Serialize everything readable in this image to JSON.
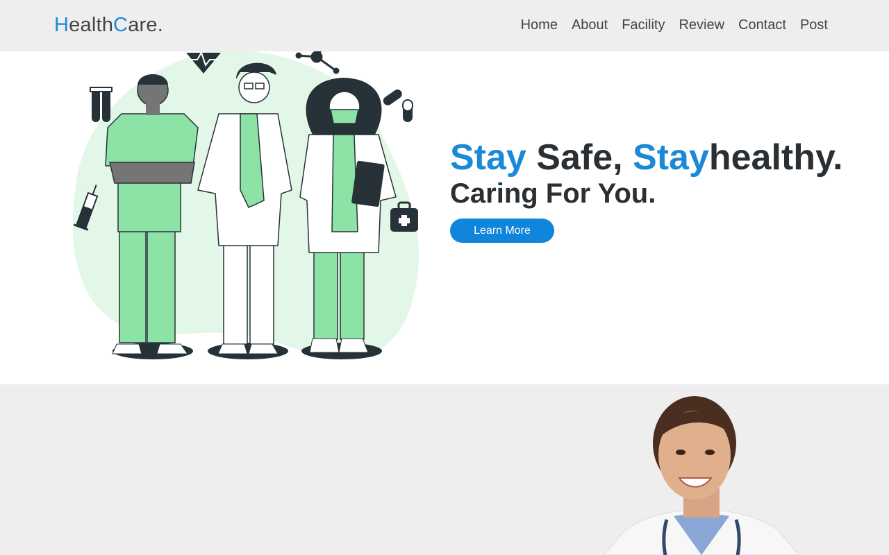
{
  "header": {
    "logo": {
      "h": "H",
      "ealth": "ealth",
      "c": "C",
      "are": "are."
    },
    "nav": [
      "Home",
      "About",
      "Facility",
      "Review",
      "Contact",
      "Post"
    ]
  },
  "hero": {
    "headline": {
      "stay1": "Stay",
      "safe": " Safe, ",
      "stay2": "Stay",
      "healthy": "healthy."
    },
    "subline": "Caring For You.",
    "cta_label": "Learn More"
  },
  "colors": {
    "accent": "#1a8ad8",
    "button": "#0f85db",
    "green": "#8de3a5",
    "dark": "#263238"
  },
  "icons": [
    "heartbeat-icon",
    "molecule-icon",
    "test-tubes-icon",
    "pills-icon",
    "syringe-icon",
    "first-aid-kit-icon"
  ]
}
